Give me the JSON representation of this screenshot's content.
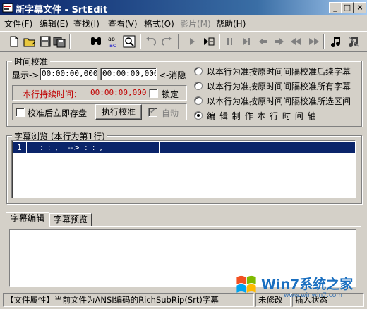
{
  "window": {
    "title": "新字幕文件 - SrtEdit"
  },
  "titlebar_buttons": {
    "minimize": "_",
    "maximize": "□",
    "close": "×"
  },
  "menu": [
    {
      "label": "文件(F)"
    },
    {
      "label": "编辑(E)"
    },
    {
      "label": "查找(I)"
    },
    {
      "label": "查看(V)"
    },
    {
      "label": "格式(O)"
    },
    {
      "label": "影片(M)"
    },
    {
      "label": "帮助(H)"
    }
  ],
  "toolbar": {
    "icons": [
      "new-file-icon",
      "open-folder-icon",
      "save-icon",
      "save-as-icon",
      "find-icon",
      "replace-icon",
      "zoom-icon",
      "undo-icon",
      "redo-icon",
      "play-icon",
      "play-to-icon",
      "pause-icon",
      "step-end-icon",
      "prev-icon",
      "next-icon",
      "rewind-icon",
      "forward-icon",
      "music-note-icon",
      "music-note-alt-icon"
    ],
    "colors": {
      "accent": "#0a246a",
      "disabled": "#808080"
    }
  },
  "timing": {
    "group_label": "时间校准",
    "display_label": "显示->",
    "start_time": "00:00:00,000",
    "end_time": "00:00:00,000",
    "cancel_label": "<-消隐",
    "duration_label": "本行持续时间：",
    "duration_value": "00:00:00,000",
    "lock_label": "锁定",
    "autosave_label": "校准后立即存盘",
    "execute_button": "执行校准",
    "auto_label": "自动",
    "options": [
      {
        "label": "以本行为准按原时间间隔校准后续字幕",
        "selected": false
      },
      {
        "label": "以本行为准按原时间间隔校准所有字幕",
        "selected": false
      },
      {
        "label": "以本行为准按原时间间隔校准所选区间",
        "selected": false
      },
      {
        "label": "编 辑 制 作 本 行 时 间 轴",
        "selected": true
      }
    ]
  },
  "browse": {
    "group_label": "字幕浏览 (本行为第1行)",
    "rows": [
      {
        "num": "1",
        "text": ":  :  ,    -->  :  :  ,"
      }
    ]
  },
  "tabs": [
    {
      "label": "字幕编辑"
    },
    {
      "label": "字幕预览"
    }
  ],
  "status": {
    "file_info": "【文件属性】当前文件为ANSI编码的RichSubRip(Srt)字幕",
    "modified": "未修改",
    "mode": "插入状态"
  },
  "watermark": {
    "text": "Win7系统之家",
    "url": "www.winwin7.com"
  }
}
